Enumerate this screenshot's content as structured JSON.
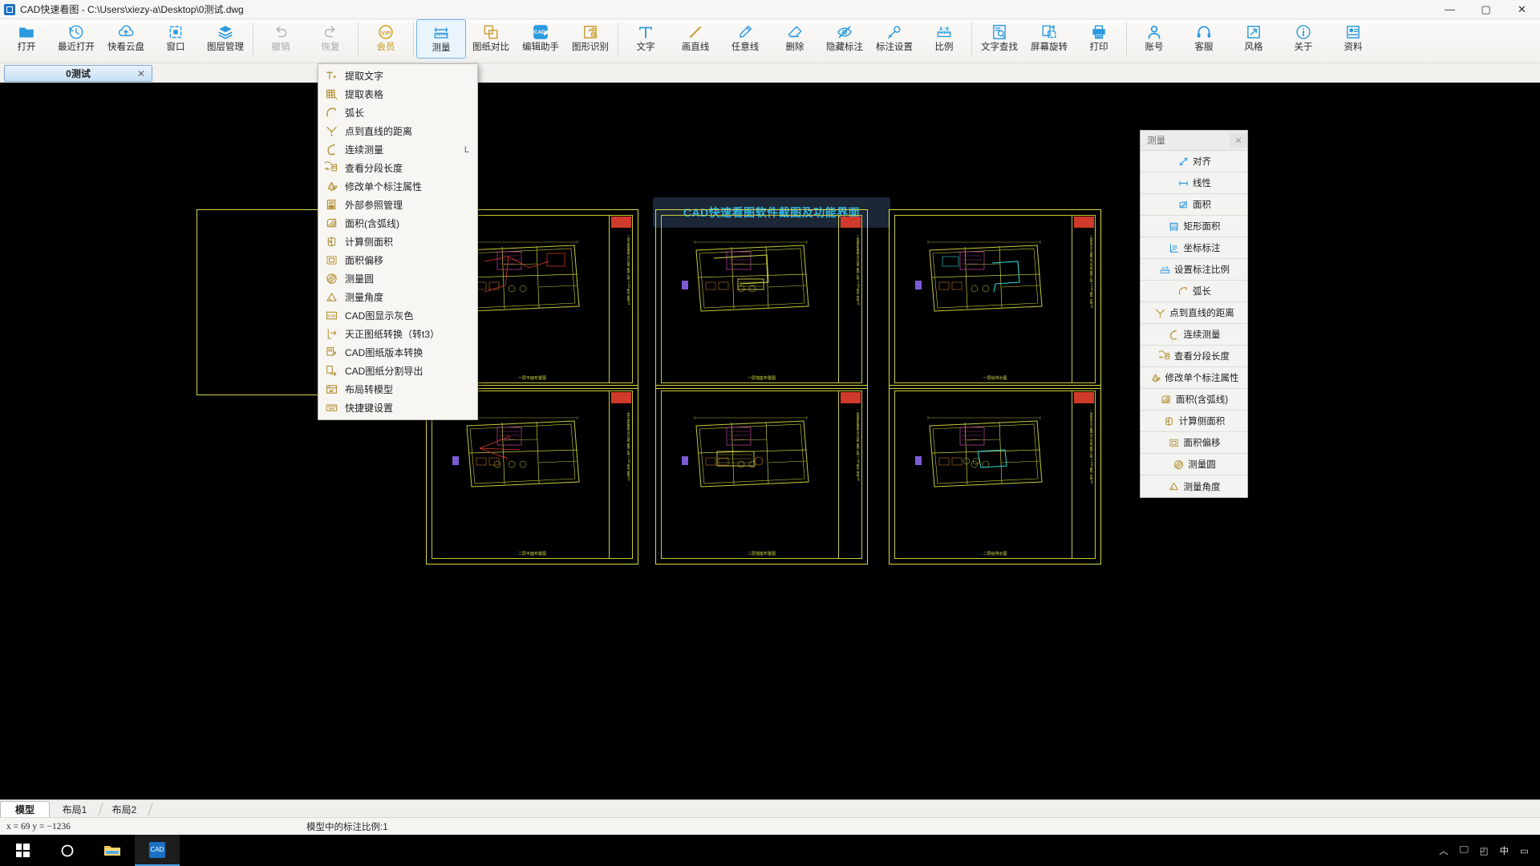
{
  "window": {
    "title": "CAD快速看图 - C:\\Users\\xiezy-a\\Desktop\\0测试.dwg",
    "app_icon": "cad-app-icon",
    "minimize": "—",
    "maximize": "▢",
    "close": "✕"
  },
  "toolbar": {
    "items": [
      {
        "label": "打开",
        "icon": "folder-open-icon",
        "state": "normal"
      },
      {
        "label": "最近打开",
        "icon": "recent-clock-icon",
        "state": "normal"
      },
      {
        "label": "快看云盘",
        "icon": "cloud-icon",
        "state": "normal"
      },
      {
        "label": "窗口",
        "icon": "window-icon",
        "state": "normal"
      },
      {
        "label": "图层管理",
        "icon": "layers-icon",
        "state": "normal"
      },
      {
        "label": "撤销",
        "icon": "undo-arrow-icon",
        "state": "disabled"
      },
      {
        "label": "恢复",
        "icon": "redo-arrow-icon",
        "state": "disabled"
      },
      {
        "label": "会员",
        "icon": "vip-badge-icon",
        "state": "vip"
      },
      {
        "label": "测量",
        "icon": "measure-ruler-icon",
        "state": "active"
      },
      {
        "label": "图纸对比",
        "icon": "compare-sheets-icon",
        "state": "normal"
      },
      {
        "label": "编辑助手",
        "icon": "cad-edit-assistant-icon",
        "state": "normal"
      },
      {
        "label": "图形识别",
        "icon": "shape-recognize-icon",
        "state": "normal"
      },
      {
        "label": "文字",
        "icon": "text-tool-icon",
        "state": "normal"
      },
      {
        "label": "画直线",
        "icon": "line-tool-icon",
        "state": "normal"
      },
      {
        "label": "任意线",
        "icon": "pen-freehand-icon",
        "state": "normal"
      },
      {
        "label": "删除",
        "icon": "eraser-icon",
        "state": "normal"
      },
      {
        "label": "隐藏标注",
        "icon": "hide-annotation-eye-icon",
        "state": "normal"
      },
      {
        "label": "标注设置",
        "icon": "annotation-settings-icon",
        "state": "normal"
      },
      {
        "label": "比例",
        "icon": "scale-ab-ruler-icon",
        "state": "normal"
      },
      {
        "label": "文字查找",
        "icon": "text-search-icon",
        "state": "normal"
      },
      {
        "label": "屏幕旋转",
        "icon": "screen-rotate-icon",
        "state": "normal"
      },
      {
        "label": "打印",
        "icon": "printer-icon",
        "state": "normal"
      },
      {
        "label": "账号",
        "icon": "user-account-icon",
        "state": "normal"
      },
      {
        "label": "客服",
        "icon": "headset-support-icon",
        "state": "normal"
      },
      {
        "label": "风格",
        "icon": "style-expand-icon",
        "state": "normal"
      },
      {
        "label": "关于",
        "icon": "info-circle-icon",
        "state": "normal"
      },
      {
        "label": "资料",
        "icon": "documents-icon",
        "state": "normal"
      }
    ]
  },
  "document_tabs": [
    {
      "label": "0测试",
      "close": "✕",
      "active": true
    }
  ],
  "canvas": {
    "watermark": "CAD快速看图软件截图及功能界面",
    "sheets": [
      {
        "caption": "一层平面布置图",
        "titleblock_text": "一层平面布置图 设计说明 图例 比例 1:100 图号 建施-01"
      },
      {
        "caption": "一层插座布置图",
        "titleblock_text": "一层插座布置图 设计说明 图例 比例 1:100 图号 电施-02"
      },
      {
        "caption": "一层给排水图",
        "titleblock_text": "一层给排水平面图 设计说明 图例 比例 1:100 图号 水施-03"
      },
      {
        "caption": "二层平面布置图",
        "titleblock_text": "二层平面布置图 设计说明 图例 比例 1:100 图号 建施-04"
      },
      {
        "caption": "二层插座布置图",
        "titleblock_text": "二层插座布置图 设计说明 图例 比例 1:100 图号 电施-05"
      },
      {
        "caption": "二层给排水图",
        "titleblock_text": "二层给排水平面图 设计说明 图例 比例 1:100 图号 水施-06"
      }
    ]
  },
  "measure_menu": {
    "items": [
      {
        "label": "提取文字",
        "icon": "extract-text-icon",
        "accel": ""
      },
      {
        "label": "提取表格",
        "icon": "extract-table-icon",
        "accel": ""
      },
      {
        "label": "弧长",
        "icon": "arc-length-icon",
        "accel": ""
      },
      {
        "label": "点到直线的距离",
        "icon": "point-to-line-icon",
        "accel": ""
      },
      {
        "label": "连续测量",
        "icon": "continuous-measure-icon",
        "accel": "L"
      },
      {
        "label": "查看分段长度",
        "icon": "segment-length-icon",
        "accel": ""
      },
      {
        "label": "修改单个标注属性",
        "icon": "edit-annotation-icon",
        "accel": ""
      },
      {
        "label": "外部参照管理",
        "icon": "xref-manager-icon",
        "accel": ""
      },
      {
        "label": "面积(含弧线)",
        "icon": "area-with-arc-icon",
        "accel": ""
      },
      {
        "label": "计算侧面积",
        "icon": "side-area-icon",
        "accel": ""
      },
      {
        "label": "面积偏移",
        "icon": "area-offset-icon",
        "accel": ""
      },
      {
        "label": "测量圆",
        "icon": "measure-circle-icon",
        "accel": ""
      },
      {
        "label": "测量角度",
        "icon": "measure-angle-icon",
        "accel": ""
      },
      {
        "label": "CAD图显示灰色",
        "icon": "cad-gray-display-icon",
        "accel": ""
      },
      {
        "label": "天正图纸转换（转t3）",
        "icon": "tangent-convert-icon",
        "accel": ""
      },
      {
        "label": "CAD图纸版本转换",
        "icon": "version-convert-icon",
        "accel": ""
      },
      {
        "label": "CAD图纸分割导出",
        "icon": "split-export-icon",
        "accel": ""
      },
      {
        "label": "布局转模型",
        "icon": "layout-to-model-icon",
        "accel": ""
      },
      {
        "label": "快捷键设置",
        "icon": "hotkey-settings-icon",
        "accel": ""
      }
    ]
  },
  "measure_panel": {
    "title": "测量",
    "close": "✕",
    "items": [
      {
        "label": "对齐",
        "icon": "align-measure-icon"
      },
      {
        "label": "线性",
        "icon": "linear-measure-icon"
      },
      {
        "label": "面积",
        "icon": "area-measure-icon"
      },
      {
        "label": "矩形面积",
        "icon": "rect-area-icon"
      },
      {
        "label": "坐标标注",
        "icon": "coordinate-dim-icon"
      },
      {
        "label": "设置标注比例",
        "icon": "set-dim-scale-icon"
      },
      {
        "label": "弧长",
        "icon": "arc-length-icon"
      },
      {
        "label": "点到直线的距离",
        "icon": "point-to-line-icon"
      },
      {
        "label": "连续测量",
        "icon": "continuous-measure-icon"
      },
      {
        "label": "查看分段长度",
        "icon": "segment-length-icon"
      },
      {
        "label": "修改单个标注属性",
        "icon": "edit-annotation-icon"
      },
      {
        "label": "面积(含弧线)",
        "icon": "area-with-arc-icon"
      },
      {
        "label": "计算侧面积",
        "icon": "side-area-icon"
      },
      {
        "label": "面积偏移",
        "icon": "area-offset-icon"
      },
      {
        "label": "测量圆",
        "icon": "measure-circle-icon"
      },
      {
        "label": "测量角度",
        "icon": "measure-angle-icon"
      }
    ]
  },
  "layout_tabs": [
    {
      "label": "模型",
      "selected": true
    },
    {
      "label": "布局1",
      "selected": false
    },
    {
      "label": "布局2",
      "selected": false
    }
  ],
  "status": {
    "coordinates": "x = 69  y = −1236",
    "scale": "模型中的标注比例:1"
  },
  "taskbar": {
    "buttons": [
      {
        "icon": "windows-start-icon",
        "active": false
      },
      {
        "icon": "cortana-search-icon",
        "active": false
      },
      {
        "icon": "file-explorer-icon",
        "active": false
      },
      {
        "icon": "cad-app-icon",
        "active": true
      }
    ],
    "tray": {
      "chevron": "︿",
      "monitor": "🖵",
      "network": "◰",
      "ime": "中",
      "more": "▭"
    }
  },
  "colors": {
    "accent_blue": "#2b9ae0",
    "menu_gold": "#b39031",
    "watermark_text": "#2fb7e8",
    "sheet_yellow": "#d8d844",
    "titleblock_red": "#d03a2a"
  }
}
